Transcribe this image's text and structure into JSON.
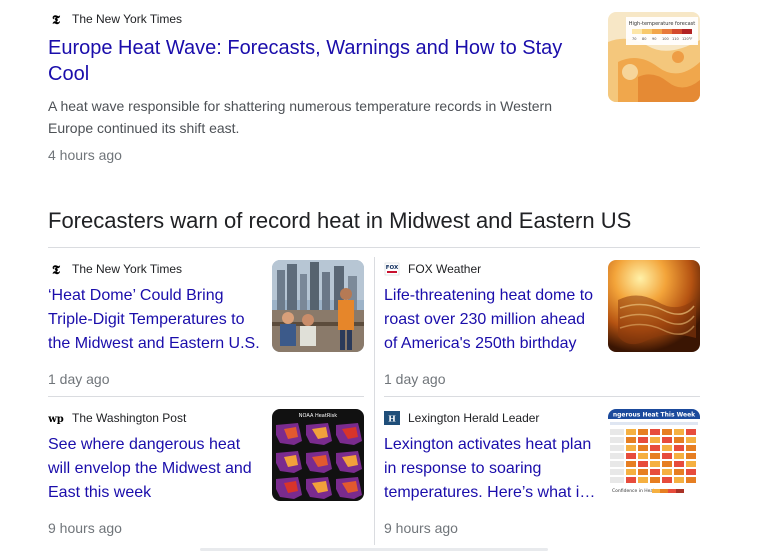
{
  "top_story": {
    "source": "The New York Times",
    "source_icon": "nyt-logo-icon",
    "title": "Europe Heat Wave: Forecasts, Warnings and How to Stay Cool",
    "snippet": "A heat wave responsible for shattering numerous temperature records in Western Europe continued its shift east.",
    "time": "4 hours ago",
    "thumb_caption": "High-temperature forecast",
    "thumb_scale": [
      "70",
      "80",
      "90",
      "100",
      "110",
      "120°F"
    ]
  },
  "cluster": {
    "heading": "Forecasters warn of record heat in Midwest and Eastern US",
    "cards": [
      {
        "source": "The New York Times",
        "source_icon": "nyt-logo-icon",
        "title": "‘Heat Dome’ Could Bring Triple-Digit Temperatures to the Midwest and Eastern U.S.",
        "time": "1 day ago"
      },
      {
        "source": "FOX Weather",
        "source_icon": "fox-logo-icon",
        "title": "Life-threatening heat dome to roast over 230 million ahead of America's 250th birthday",
        "time": "1 day ago"
      },
      {
        "source": "The Washington Post",
        "source_icon": "wapo-logo-icon",
        "title": "See where dangerous heat will envelop the Midwest and East this week",
        "time": "9 hours ago",
        "thumb_caption": "NOAA HeatRisk"
      },
      {
        "source": "Lexington Herald Leader",
        "source_icon": "lexington-logo-icon",
        "title": "Lexington activates heat plan in response to soaring temperatures. Here’s what is open",
        "time": "9 hours ago",
        "thumb_caption": "ngerous Heat This Week",
        "thumb_footer": "Confidence in Heat"
      }
    ]
  },
  "colors": {
    "link": "#1a0dab",
    "source_text": "#202124",
    "snippet": "#4d5156",
    "time": "#70757a",
    "divider": "#dadce0"
  }
}
